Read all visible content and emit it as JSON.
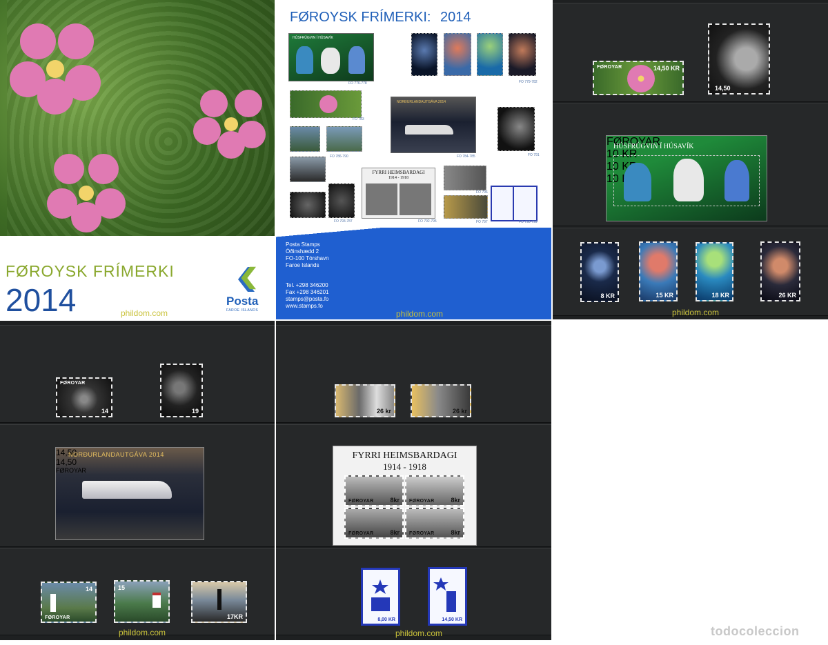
{
  "cover": {
    "title": "FØROYSK FRÍMERKI",
    "year": "2014",
    "logo_name": "Posta",
    "logo_sub": "FAROE ISLANDS",
    "watermark": "phildom.com"
  },
  "overview": {
    "title": "FØROYSK FRÍMERKI:",
    "year": "2014",
    "sheet_tale": "HÚSFRÚGVIN Í HÚSAVÍK",
    "sheet_norden": "NORÐURLANDAUTGÁVA 2014",
    "sheet_ww1_line1": "FYRRI HEIMSBARDAGI",
    "sheet_ww1_line2": "1914 - 1918",
    "codes": [
      "FO 776-778",
      "FO 779-782",
      "FO 783",
      "FO 784-785",
      "FO 791",
      "FO 786-790",
      "FO 796",
      "FO 792-795",
      "FO 797",
      "FO 798-799",
      "FO 793-787"
    ],
    "address": [
      "Posta Stamps",
      "Óðinshædd 2",
      "FO-100 Tórshavn",
      "Faroe Islands"
    ],
    "contact": [
      "Tel. +298 346200",
      "Fax +298 346201",
      "stamps@posta.fo",
      "www.stamps.fo"
    ],
    "watermark": "phildom.com"
  },
  "sheet1": {
    "rose_value": "14,50 KR",
    "portrait_value": "14,50",
    "tale_title": "HÚSFRÚGVIN Í HÚSAVÍK",
    "tale_values": [
      "10 KR",
      "10 KR",
      "10 KR"
    ],
    "jelly_values": [
      "8 KR",
      "15 KR",
      "18 KR",
      "26 KR"
    ],
    "country": "FØROYAR",
    "watermark": "phildom.com"
  },
  "sheet2": {
    "music_values": [
      "14",
      "19"
    ],
    "norden_title": "NORÐURLANDAUTGÁVA 2014",
    "norden_values": [
      "14,50",
      "14,50"
    ],
    "lighthouse_values": [
      "14",
      "15",
      "17KR"
    ],
    "country": "FØROYAR",
    "watermark": "phildom.com"
  },
  "sheet3": {
    "top_values": [
      "26 kr",
      "26 kr"
    ],
    "ww1_line1": "FYRRI HEIMSBARDAGI",
    "ww1_line2": "1914 - 1918",
    "ww1_values": [
      "8kr",
      "8kr",
      "8kr",
      "8kr"
    ],
    "blue_values": [
      "8,00 KR",
      "14,50 KR"
    ],
    "country": "FØROYAR",
    "watermark": "phildom.com"
  },
  "footer": {
    "brand": "todocoleccion"
  },
  "colors": {
    "posta_blue": "#1f5fb8",
    "posta_green": "#8ab83a",
    "watermark": "#c9c23a",
    "navy": "#1e3a8a"
  }
}
